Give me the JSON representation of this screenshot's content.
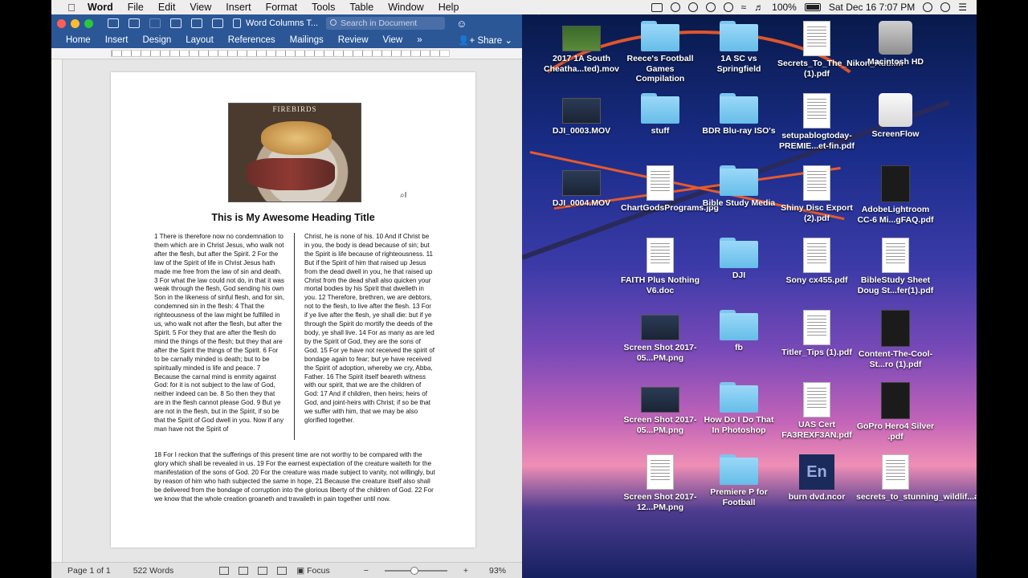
{
  "menubar": {
    "app": "Word",
    "items": [
      "File",
      "Edit",
      "View",
      "Insert",
      "Format",
      "Tools",
      "Table",
      "Window",
      "Help"
    ],
    "battery": "100%",
    "clock": "Sat Dec 16  7:07 PM"
  },
  "word": {
    "doc_title": "Word Columns T...",
    "search_placeholder": "Search in Document",
    "tabs": [
      "Home",
      "Insert",
      "Design",
      "Layout",
      "References",
      "Mailings",
      "Review",
      "View"
    ],
    "more": "»",
    "share": "Share",
    "document": {
      "heading": "This is My Awesome Heading Title",
      "photo_brand": "FIREBIRDS",
      "col1": "1 There is therefore now no condemnation to them which are in Christ Jesus, who walk not after the flesh, but after the Spirit. 2 For the law of the Spirit of life in Christ Jesus hath made me free from the law of sin and death. 3 For what the law could not do, in that it was weak through the flesh, God sending his own Son in the likeness of sinful flesh, and for sin, condemned sin in the flesh: 4 That the righteousness of the law might be fulfilled in us, who walk not after the flesh, but after the Spirit. 5 For they that are after the flesh do mind the things of the flesh; but they that are after the Spirit the things of the Spirit. 6 For to be carnally minded is death; but to be spiritually minded is life and peace. 7 Because the carnal mind is enmity against God: for it is not subject to the law of God, neither indeed can be. 8 So then they that are in the flesh cannot please God. 9 But ye are not in the flesh, but in the Spirit, if so be that the Spirit of God dwell in you. Now if any man have not the Spirit of",
      "col2": "Christ, he is none of his. 10 And if Christ be in you, the body is dead because of sin; but the Spirit is life because of righteousness. 11 But if the Spirit of him that raised up Jesus from the dead dwell in you, he that raised up Christ from the dead shall also quicken your mortal bodies by his Spirit that dwelleth in you. 12 Therefore, brethren, we are debtors, not to the flesh, to live after the flesh. 13 For if ye live after the flesh, ye shall die: but if ye through the Spirit do mortify the deeds of the body, ye shall live. 14 For as many as are led by the Spirit of God, they are the sons of God. 15 For ye have not received the spirit of bondage again to fear; but ye have received the Spirit of adoption, whereby we cry, Abba, Father. 16 The Spirit itself beareth witness with our spirit, that we are the children of God: 17 And if children, then heirs; heirs of God, and joint-heirs with Christ; if so be that we suffer with him, that we may be also glorified together.",
      "full": "18 For I reckon that the sufferings of this present time are not worthy to be compared with the glory which shall be revealed in us. 19 For the earnest expectation of the creature waiteth for the manifestation of the sons of God. 20 For the creature was made subject to vanity, not willingly, but by reason of him who hath subjected the same in hope, 21 Because the creature itself also shall be delivered from the bondage of corruption into the glorious liberty of the children of God. 22 For we know that the whole creation groaneth and travaileth in pain together until now."
    },
    "status": {
      "page": "Page 1 of 1",
      "words": "522 Words",
      "focus": "Focus",
      "zoom": "93%"
    }
  },
  "desktop": {
    "icons": [
      {
        "label": "2017 1A South Cheatha...ted).mov",
        "kind": "video-field"
      },
      {
        "label": "Reece's Football Games Compilation",
        "kind": "folder"
      },
      {
        "label": "1A SC vs Springfield",
        "kind": "folder"
      },
      {
        "label": "Secrets_To_The_Nikon_Aut...m (1).pdf",
        "kind": "doc"
      },
      {
        "label": "Macintosh HD",
        "kind": "disk"
      },
      {
        "label": "DJI_0003.MOV",
        "kind": "video"
      },
      {
        "label": "stuff",
        "kind": "folder"
      },
      {
        "label": "BDR Blu-ray ISO's",
        "kind": "folder"
      },
      {
        "label": "setupablogtoday-PREMIE...et-fin.pdf",
        "kind": "doc"
      },
      {
        "label": "ScreenFlow",
        "kind": "disk-white"
      },
      {
        "label": "DJI_0004.MOV",
        "kind": "video"
      },
      {
        "label": "ChartGodsPrograms.jpg",
        "kind": "doc"
      },
      {
        "label": "Bible Study Media",
        "kind": "folder"
      },
      {
        "label": "Shiny Disc Export (2).pdf",
        "kind": "doc"
      },
      {
        "label": "AdobeLightroom CC-6 Mi...gFAQ.pdf",
        "kind": "dark"
      },
      {
        "label": "FAITH Plus Nothing V6.doc",
        "kind": "doc"
      },
      {
        "label": "DJI",
        "kind": "folder"
      },
      {
        "label": "Sony cx455.pdf",
        "kind": "doc"
      },
      {
        "label": "BibleStudy Sheet Doug St...fer(1).pdf",
        "kind": "doc"
      },
      {
        "label": "Screen Shot 2017-05...PM.png",
        "kind": "video"
      },
      {
        "label": "fb",
        "kind": "folder"
      },
      {
        "label": "Titler_Tips (1).pdf",
        "kind": "doc"
      },
      {
        "label": "Content-The-Cool-St...ro (1).pdf",
        "kind": "dark"
      },
      {
        "label": "Screen Shot 2017-05...PM.png",
        "kind": "video"
      },
      {
        "label": "How Do I Do That In Photoshop",
        "kind": "folder"
      },
      {
        "label": "UAS Cert FA3REXF3AN.pdf",
        "kind": "doc"
      },
      {
        "label": "GoPro Hero4 Silver .pdf",
        "kind": "dark"
      },
      {
        "label": "Screen Shot 2017-12...PM.png",
        "kind": "doc"
      },
      {
        "label": "Premiere P for Football",
        "kind": "folder"
      },
      {
        "label": "burn dvd.ncor",
        "kind": "en"
      },
      {
        "label": "secrets_to_stunning_wildlif...aphy.pdf",
        "kind": "doc"
      }
    ]
  }
}
